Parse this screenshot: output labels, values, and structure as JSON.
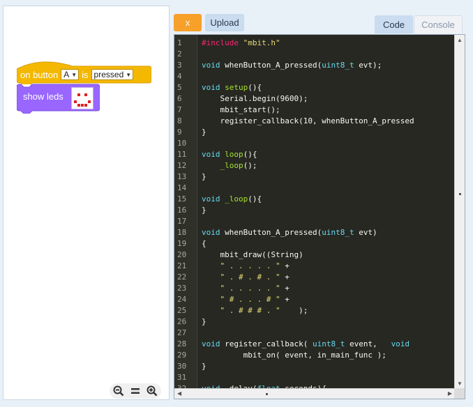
{
  "blocks": {
    "hat": {
      "prefix": "on button",
      "button_value": "A",
      "middle": "is",
      "state_value": "pressed"
    },
    "show_leds": {
      "label": "show leds",
      "led_rows": [
        [
          0,
          0,
          0,
          0,
          0
        ],
        [
          0,
          1,
          0,
          1,
          0
        ],
        [
          0,
          0,
          0,
          0,
          0
        ],
        [
          1,
          0,
          0,
          0,
          1
        ],
        [
          0,
          1,
          1,
          1,
          0
        ]
      ]
    }
  },
  "colors": {
    "event_block": "#f5b800",
    "looks_block": "#9966ff",
    "x_button": "#f7a02a",
    "editor_bg": "#272822"
  },
  "zoom": {
    "zoom_out_icon": "zoom-out-icon",
    "reset_icon": "reset-zoom-icon",
    "zoom_in_icon": "zoom-in-icon"
  },
  "toolbar": {
    "x_label": "x",
    "upload_label": "Upload"
  },
  "tabs": {
    "code": "Code",
    "console": "Console"
  },
  "code": [
    {
      "n": "1",
      "t": [
        [
          "macro",
          "#include "
        ],
        [
          "str",
          "\"mbit.h\""
        ]
      ]
    },
    {
      "n": "2",
      "t": []
    },
    {
      "n": "3",
      "t": [
        [
          "kw",
          "void "
        ],
        [
          "plain",
          "whenButton_A_pressed("
        ],
        [
          "kw",
          "uint8_t "
        ],
        [
          "plain",
          "evt);"
        ]
      ]
    },
    {
      "n": "4",
      "t": []
    },
    {
      "n": "5",
      "t": [
        [
          "kw",
          "void "
        ],
        [
          "fn",
          "setup"
        ],
        [
          "plain",
          "(){"
        ]
      ]
    },
    {
      "n": "6",
      "t": [
        [
          "plain",
          "    Serial.begin(9600);"
        ]
      ]
    },
    {
      "n": "7",
      "t": [
        [
          "plain",
          "    mbit_start();"
        ]
      ]
    },
    {
      "n": "8",
      "t": [
        [
          "plain",
          "    register_callback(10, whenButton_A_pressed"
        ]
      ]
    },
    {
      "n": "9",
      "t": [
        [
          "plain",
          "}"
        ]
      ]
    },
    {
      "n": "10",
      "t": []
    },
    {
      "n": "11",
      "t": [
        [
          "kw",
          "void "
        ],
        [
          "fn",
          "loop"
        ],
        [
          "plain",
          "(){"
        ]
      ]
    },
    {
      "n": "12",
      "t": [
        [
          "plain",
          "    "
        ],
        [
          "fn",
          "_loop"
        ],
        [
          "plain",
          "();"
        ]
      ]
    },
    {
      "n": "13",
      "t": [
        [
          "plain",
          "}"
        ]
      ]
    },
    {
      "n": "14",
      "t": []
    },
    {
      "n": "15",
      "t": [
        [
          "kw",
          "void "
        ],
        [
          "fn",
          "_loop"
        ],
        [
          "plain",
          "(){"
        ]
      ]
    },
    {
      "n": "16",
      "t": [
        [
          "plain",
          "}"
        ]
      ]
    },
    {
      "n": "17",
      "t": []
    },
    {
      "n": "18",
      "t": [
        [
          "kw",
          "void "
        ],
        [
          "plain",
          "whenButton_A_pressed("
        ],
        [
          "kw",
          "uint8_t "
        ],
        [
          "plain",
          "evt)"
        ]
      ]
    },
    {
      "n": "19",
      "t": [
        [
          "plain",
          "{"
        ]
      ]
    },
    {
      "n": "20",
      "t": [
        [
          "plain",
          "    mbit_draw((String)"
        ]
      ]
    },
    {
      "n": "21",
      "t": [
        [
          "plain",
          "    "
        ],
        [
          "str",
          "\" . . . . . \""
        ],
        [
          "plain",
          " +"
        ]
      ]
    },
    {
      "n": "22",
      "t": [
        [
          "plain",
          "    "
        ],
        [
          "str",
          "\" . # . # . \""
        ],
        [
          "plain",
          " +"
        ]
      ]
    },
    {
      "n": "23",
      "t": [
        [
          "plain",
          "    "
        ],
        [
          "str",
          "\" . . . . . \""
        ],
        [
          "plain",
          " +"
        ]
      ]
    },
    {
      "n": "24",
      "t": [
        [
          "plain",
          "    "
        ],
        [
          "str",
          "\" # . . . # \""
        ],
        [
          "plain",
          " +"
        ]
      ]
    },
    {
      "n": "25",
      "t": [
        [
          "plain",
          "    "
        ],
        [
          "str",
          "\" . # # # . \""
        ],
        [
          "plain",
          "    );"
        ]
      ]
    },
    {
      "n": "26",
      "t": [
        [
          "plain",
          "}"
        ]
      ]
    },
    {
      "n": "27",
      "t": []
    },
    {
      "n": "28",
      "t": [
        [
          "kw",
          "void "
        ],
        [
          "plain",
          "register_callback( "
        ],
        [
          "kw",
          "uint8_t "
        ],
        [
          "plain",
          "event,   "
        ],
        [
          "kw",
          "void"
        ]
      ]
    },
    {
      "n": "29",
      "t": [
        [
          "plain",
          "         mbit_on( event, in_main_func );"
        ]
      ]
    },
    {
      "n": "30",
      "t": [
        [
          "plain",
          "}"
        ]
      ]
    },
    {
      "n": "31",
      "t": []
    },
    {
      "n": "32",
      "t": [
        [
          "kw",
          "void "
        ],
        [
          "plain",
          "_delay("
        ],
        [
          "kw",
          "float "
        ],
        [
          "plain",
          "seconds){"
        ]
      ]
    }
  ]
}
